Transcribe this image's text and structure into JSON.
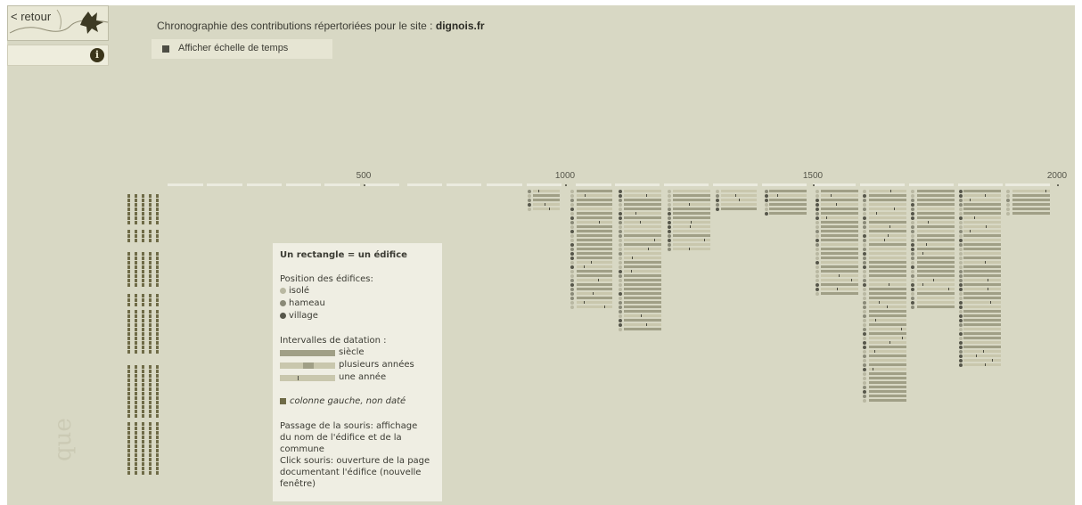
{
  "nav": {
    "back_label": "< retour",
    "info_icon": "info-icon"
  },
  "header": {
    "title_prefix": "Chronographie des contributions répertoriées pour le site :",
    "site_name": "dignois.fr",
    "toggle_label": "Afficher échelle de temps"
  },
  "timeline": {
    "ticks": [
      "500",
      "1000",
      "1500",
      "2000"
    ]
  },
  "legend": {
    "title": "Un rectangle = un édifice",
    "position_heading": "Position des édifices:",
    "positions": [
      "isolé",
      "hameau",
      "village"
    ],
    "intervals_heading": "Intervalles de datation :",
    "intervals": [
      "siècle",
      "plusieurs années",
      "une année"
    ],
    "undated_label": "colonne gauche, non daté",
    "hover_text_1": "Passage de la souris: affichage",
    "hover_text_2": "du nom de l'édifice et de la",
    "hover_text_3": "commune",
    "click_text_1": "Click souris: ouverture de la page",
    "click_text_2": "documentant l'édifice (nouvelle",
    "click_text_3": "fenêtre)"
  },
  "colors": {
    "background": "#d8d8c4",
    "bar_dark": "#a09f86",
    "bar_light": "#c9c7ad",
    "dot_isole": "#b9b8a2",
    "dot_hameau": "#8a8a78",
    "dot_village": "#57574b",
    "undated": "#6f6b47"
  }
}
